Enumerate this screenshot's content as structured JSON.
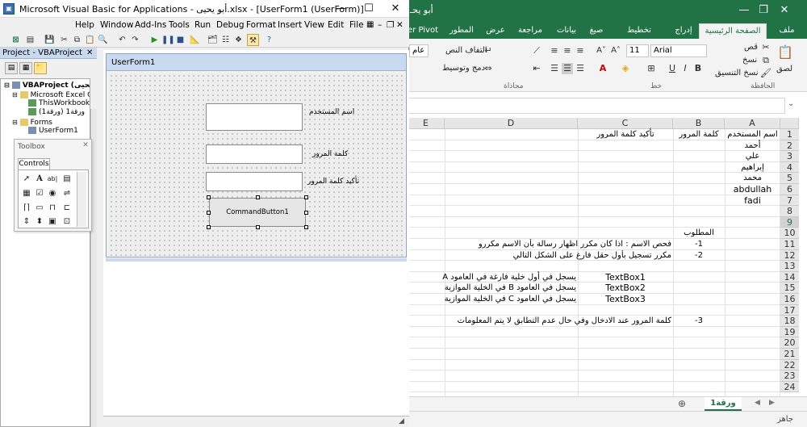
{
  "excel": {
    "title_partial": "أبو يحـ",
    "tabs": [
      "ملف",
      "الصفحة الرئيسية",
      "إدراج",
      "تخطيط الصفحة",
      "صيغ",
      "بيانات",
      "مراجعة",
      "عرض",
      "المطور",
      "er Pivot"
    ],
    "active_tab": "الصفحة الرئيسية",
    "ribbon": {
      "paste_label": "لصق",
      "cut_label": "قص",
      "copy_label": "نسخ",
      "format_painter_label": "نسخ التنسيق",
      "clipboard_group": "الحافظة",
      "font_name": "Arial",
      "font_size": "11",
      "font_group": "خط",
      "wrap_text_label": "التفاف النص",
      "merge_label": "دمج وتوسيط",
      "alignment_group": "محاذاة",
      "number_format_partial": "عام",
      "bold_label": "B",
      "italic_label": "I",
      "underline_label": "U"
    },
    "columns": [
      "A",
      "B",
      "C",
      "D",
      "E"
    ],
    "rows": [
      "1",
      "2",
      "3",
      "4",
      "5",
      "6",
      "7",
      "8",
      "9",
      "10",
      "11",
      "12",
      "13",
      "14",
      "15",
      "16",
      "17",
      "18",
      "19",
      "20",
      "21",
      "22",
      "23",
      "24"
    ],
    "selected_row": "9",
    "cells": {
      "A1": "اسم المستخدم",
      "B1": "كلمة المرور",
      "C1": "تأكيد كلمة المرور",
      "A2": "أحمد",
      "A3": "علي",
      "A4": "إبراهيم",
      "A5": "محمد",
      "A6": "abdullah",
      "A7": "fadi",
      "B10": "المطلوب",
      "B11": "-1",
      "C11": "فحص الاسم : اذا كان مكرر اظهار رسالة بأن الاسم مكررو",
      "B12": "-2",
      "C12": "مكرر تسجيل بأول حقل فارغ على الشكل التالي",
      "C14": "TextBox1",
      "D14": "يسجل في أول خلية فارغة في العامود A",
      "C15": "TextBox2",
      "D15": "يسجل في العامود B في الخلية الموازية",
      "C16": "TextBox3",
      "D16": "يسجل في العامود C في الخلية الموازية",
      "B18": "-3",
      "C18": "كلمة المرور عند الادخال وفي حال عدم التطابق لا يتم المعلومات"
    },
    "sheet_tab": "ورقة1",
    "status_text": "جاهز"
  },
  "vba": {
    "title": "Microsoft Visual Basic for Applications - أبو يحيى.xlsx - [UserForm1 (UserForm)]",
    "menu": [
      "File",
      "Edit",
      "View",
      "Insert",
      "Format",
      "Debug",
      "Run",
      "Tools",
      "Add-Ins",
      "Window",
      "Help"
    ],
    "project_title": "Project - VBAProject",
    "tree": {
      "root": "VBAProject (أبو يحيى",
      "excel_objects": "Microsoft Excel Obje",
      "this_workbook": "ThisWorkbook",
      "sheet1": "ورقة1 (ورقة1)",
      "forms": "Forms",
      "userform": "UserForm1"
    },
    "toolbox": {
      "title": "Toolbox",
      "tab": "Controls"
    },
    "userform": {
      "caption": "UserForm1",
      "label_user": "اسم المستخدم",
      "label_password": "كلمة المرور",
      "label_confirm": "تأكيد كلمة المرور",
      "button_caption": "CommandButton1"
    }
  }
}
